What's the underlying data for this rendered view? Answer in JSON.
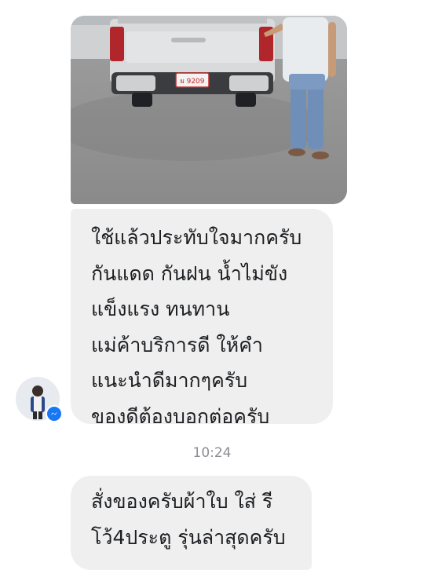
{
  "message_1": {
    "lines": [
      "ใช้แล้วประทับใจมากครับ",
      "กันแดด กันฝน น้ำไม่ขัง",
      "แข็งแรง ทนทาน",
      "แม่ค้าบริการดี ให้คำ",
      "แนะนำดีมากๆครับ",
      "ของดีต้องบอกต่อครับ"
    ]
  },
  "timestamp": "10:24",
  "message_2": {
    "lines": [
      "สั่งของครับผ้าใบ ใส่ รี",
      "โว้4ประตู รุ่นล่าสุดครับ"
    ]
  },
  "photo": {
    "plate_text": "ผ 9209",
    "truck_color": "#d9dadb"
  },
  "colors": {
    "bubble_bg": "#efefef",
    "timestamp": "#8a8d91",
    "messenger_badge": "#1877f2"
  },
  "icons": {
    "badge": "messenger-icon"
  }
}
